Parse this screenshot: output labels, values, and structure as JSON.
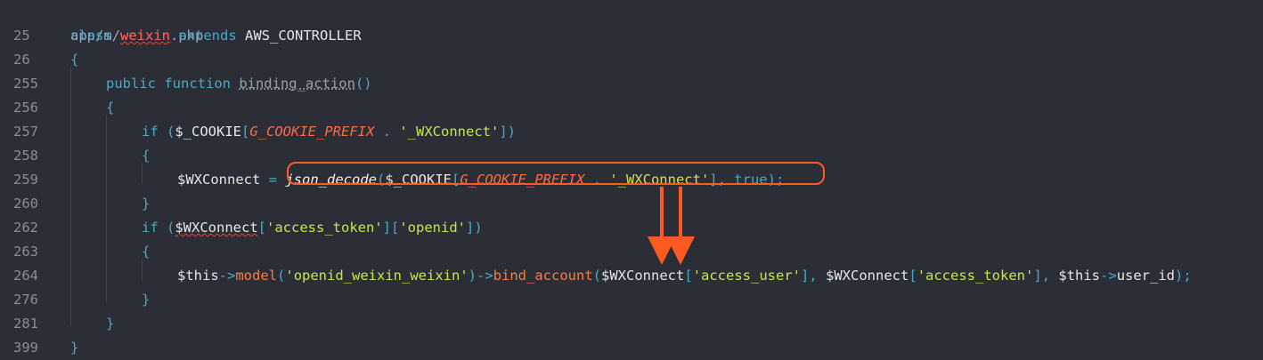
{
  "file_path": "app/m/weixin.php",
  "lines": [
    {
      "num": "25",
      "tokens": [
        [
          "kw",
          "class "
        ],
        [
          "cls",
          "weixin"
        ],
        [
          "kw",
          " extends "
        ],
        [
          "ident",
          "AWS_CONTROLLER"
        ]
      ],
      "indent": 0
    },
    {
      "num": "26",
      "tokens": [
        [
          "brace",
          "{"
        ]
      ],
      "indent": 0
    },
    {
      "num": "255",
      "tokens": [
        [
          "kw",
          "public function "
        ],
        [
          "fn-def",
          "binding_action"
        ],
        [
          "brace",
          "()"
        ]
      ],
      "indent": 1
    },
    {
      "num": "256",
      "tokens": [
        [
          "brace",
          "{"
        ]
      ],
      "indent": 1
    },
    {
      "num": "257",
      "tokens": [
        [
          "kw",
          "if "
        ],
        [
          "brace",
          "("
        ],
        [
          "var",
          "$_COOKIE"
        ],
        [
          "brace",
          "["
        ],
        [
          "const",
          "G_COOKIE_PREFIX"
        ],
        [
          "op",
          " . "
        ],
        [
          "str",
          "'_WXConnect'"
        ],
        [
          "brace",
          "])"
        ]
      ],
      "indent": 2
    },
    {
      "num": "258",
      "tokens": [
        [
          "brace",
          "{"
        ]
      ],
      "indent": 2
    },
    {
      "num": "259",
      "tokens": [
        [
          "var",
          "$WXConnect "
        ],
        [
          "op",
          "= "
        ],
        [
          "fn",
          "json_decode"
        ],
        [
          "brace",
          "("
        ],
        [
          "var",
          "$_COOKIE"
        ],
        [
          "brace",
          "["
        ],
        [
          "const",
          "G_COOKIE_PREFIX"
        ],
        [
          "op",
          " . "
        ],
        [
          "str",
          "'_WXConnect'"
        ],
        [
          "brace",
          "], "
        ],
        [
          "kw",
          "true"
        ],
        [
          "brace",
          ");"
        ]
      ],
      "indent": 3
    },
    {
      "num": "260",
      "tokens": [
        [
          "brace",
          "}"
        ]
      ],
      "indent": 2
    },
    {
      "num": "262",
      "tokens": [
        [
          "kw",
          "if "
        ],
        [
          "brace",
          "("
        ],
        [
          "wavyvar",
          "$WXConnect"
        ],
        [
          "brace",
          "["
        ],
        [
          "str",
          "'access_token'"
        ],
        [
          "brace",
          "]["
        ],
        [
          "str",
          "'openid'"
        ],
        [
          "brace",
          "])"
        ]
      ],
      "indent": 2
    },
    {
      "num": "263",
      "tokens": [
        [
          "brace",
          "{"
        ]
      ],
      "indent": 2
    },
    {
      "num": "264",
      "tokens": [
        [
          "var",
          "$this"
        ],
        [
          "op",
          "->"
        ],
        [
          "meth",
          "model"
        ],
        [
          "brace",
          "("
        ],
        [
          "str",
          "'openid_weixin_weixin'"
        ],
        [
          "brace",
          ")"
        ],
        [
          "op",
          "->"
        ],
        [
          "meth",
          "bind_account"
        ],
        [
          "brace",
          "("
        ],
        [
          "var",
          "$WXConnect"
        ],
        [
          "brace",
          "["
        ],
        [
          "str",
          "'access_user'"
        ],
        [
          "brace",
          "], "
        ],
        [
          "var",
          "$WXConnect"
        ],
        [
          "brace",
          "["
        ],
        [
          "str",
          "'access_token'"
        ],
        [
          "brace",
          "], "
        ],
        [
          "var",
          "$this"
        ],
        [
          "op",
          "->"
        ],
        [
          "var",
          "user_id"
        ],
        [
          "brace",
          ");"
        ]
      ],
      "indent": 3
    },
    {
      "num": "276",
      "tokens": [
        [
          "brace",
          "}"
        ]
      ],
      "indent": 2
    },
    {
      "num": "281",
      "tokens": [
        [
          "brace",
          "}"
        ]
      ],
      "indent": 1
    },
    {
      "num": "399",
      "tokens": [
        [
          "brace",
          "}"
        ]
      ],
      "indent": 0
    }
  ],
  "colors": {
    "background": "#2b2e37",
    "highlight": "#ff5a1f"
  }
}
